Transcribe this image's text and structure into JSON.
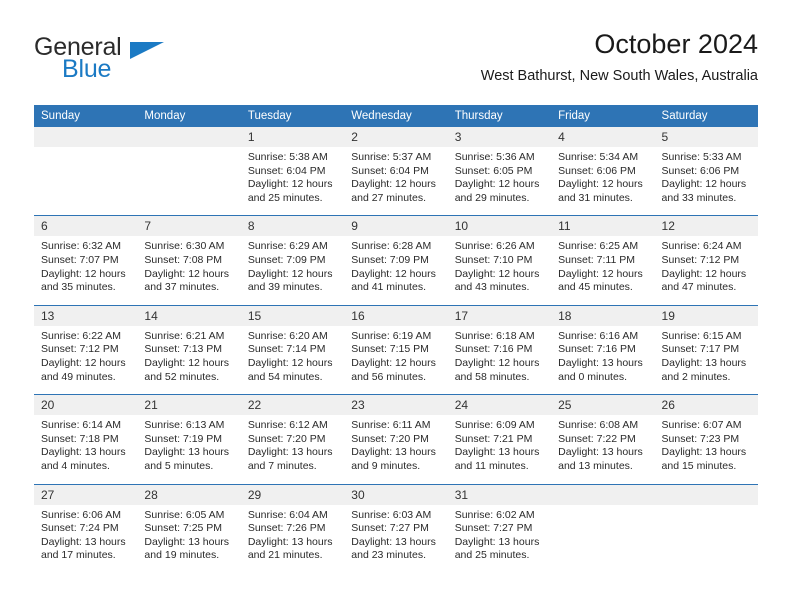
{
  "brand": {
    "name_part1": "General",
    "name_part2": "Blue",
    "accent_color": "#1b7ac4",
    "logo_icon": "triangle-icon"
  },
  "header": {
    "title": "October 2024",
    "subtitle": "West Bathurst, New South Wales, Australia"
  },
  "theme": {
    "header_blue": "#2e74b5",
    "daynum_band": "#f0f0f0",
    "cell_background": "#ffffff",
    "text": "#1a1a1a"
  },
  "calendar": {
    "day_headers": [
      "Sunday",
      "Monday",
      "Tuesday",
      "Wednesday",
      "Thursday",
      "Friday",
      "Saturday"
    ],
    "weeks": [
      {
        "days": [
          {
            "num": "",
            "sunrise": "",
            "sunset": "",
            "daylight1": "",
            "daylight2": ""
          },
          {
            "num": "",
            "sunrise": "",
            "sunset": "",
            "daylight1": "",
            "daylight2": ""
          },
          {
            "num": "1",
            "sunrise": "Sunrise: 5:38 AM",
            "sunset": "Sunset: 6:04 PM",
            "daylight1": "Daylight: 12 hours",
            "daylight2": "and 25 minutes."
          },
          {
            "num": "2",
            "sunrise": "Sunrise: 5:37 AM",
            "sunset": "Sunset: 6:04 PM",
            "daylight1": "Daylight: 12 hours",
            "daylight2": "and 27 minutes."
          },
          {
            "num": "3",
            "sunrise": "Sunrise: 5:36 AM",
            "sunset": "Sunset: 6:05 PM",
            "daylight1": "Daylight: 12 hours",
            "daylight2": "and 29 minutes."
          },
          {
            "num": "4",
            "sunrise": "Sunrise: 5:34 AM",
            "sunset": "Sunset: 6:06 PM",
            "daylight1": "Daylight: 12 hours",
            "daylight2": "and 31 minutes."
          },
          {
            "num": "5",
            "sunrise": "Sunrise: 5:33 AM",
            "sunset": "Sunset: 6:06 PM",
            "daylight1": "Daylight: 12 hours",
            "daylight2": "and 33 minutes."
          }
        ]
      },
      {
        "days": [
          {
            "num": "6",
            "sunrise": "Sunrise: 6:32 AM",
            "sunset": "Sunset: 7:07 PM",
            "daylight1": "Daylight: 12 hours",
            "daylight2": "and 35 minutes."
          },
          {
            "num": "7",
            "sunrise": "Sunrise: 6:30 AM",
            "sunset": "Sunset: 7:08 PM",
            "daylight1": "Daylight: 12 hours",
            "daylight2": "and 37 minutes."
          },
          {
            "num": "8",
            "sunrise": "Sunrise: 6:29 AM",
            "sunset": "Sunset: 7:09 PM",
            "daylight1": "Daylight: 12 hours",
            "daylight2": "and 39 minutes."
          },
          {
            "num": "9",
            "sunrise": "Sunrise: 6:28 AM",
            "sunset": "Sunset: 7:09 PM",
            "daylight1": "Daylight: 12 hours",
            "daylight2": "and 41 minutes."
          },
          {
            "num": "10",
            "sunrise": "Sunrise: 6:26 AM",
            "sunset": "Sunset: 7:10 PM",
            "daylight1": "Daylight: 12 hours",
            "daylight2": "and 43 minutes."
          },
          {
            "num": "11",
            "sunrise": "Sunrise: 6:25 AM",
            "sunset": "Sunset: 7:11 PM",
            "daylight1": "Daylight: 12 hours",
            "daylight2": "and 45 minutes."
          },
          {
            "num": "12",
            "sunrise": "Sunrise: 6:24 AM",
            "sunset": "Sunset: 7:12 PM",
            "daylight1": "Daylight: 12 hours",
            "daylight2": "and 47 minutes."
          }
        ]
      },
      {
        "days": [
          {
            "num": "13",
            "sunrise": "Sunrise: 6:22 AM",
            "sunset": "Sunset: 7:12 PM",
            "daylight1": "Daylight: 12 hours",
            "daylight2": "and 49 minutes."
          },
          {
            "num": "14",
            "sunrise": "Sunrise: 6:21 AM",
            "sunset": "Sunset: 7:13 PM",
            "daylight1": "Daylight: 12 hours",
            "daylight2": "and 52 minutes."
          },
          {
            "num": "15",
            "sunrise": "Sunrise: 6:20 AM",
            "sunset": "Sunset: 7:14 PM",
            "daylight1": "Daylight: 12 hours",
            "daylight2": "and 54 minutes."
          },
          {
            "num": "16",
            "sunrise": "Sunrise: 6:19 AM",
            "sunset": "Sunset: 7:15 PM",
            "daylight1": "Daylight: 12 hours",
            "daylight2": "and 56 minutes."
          },
          {
            "num": "17",
            "sunrise": "Sunrise: 6:18 AM",
            "sunset": "Sunset: 7:16 PM",
            "daylight1": "Daylight: 12 hours",
            "daylight2": "and 58 minutes."
          },
          {
            "num": "18",
            "sunrise": "Sunrise: 6:16 AM",
            "sunset": "Sunset: 7:16 PM",
            "daylight1": "Daylight: 13 hours",
            "daylight2": "and 0 minutes."
          },
          {
            "num": "19",
            "sunrise": "Sunrise: 6:15 AM",
            "sunset": "Sunset: 7:17 PM",
            "daylight1": "Daylight: 13 hours",
            "daylight2": "and 2 minutes."
          }
        ]
      },
      {
        "days": [
          {
            "num": "20",
            "sunrise": "Sunrise: 6:14 AM",
            "sunset": "Sunset: 7:18 PM",
            "daylight1": "Daylight: 13 hours",
            "daylight2": "and 4 minutes."
          },
          {
            "num": "21",
            "sunrise": "Sunrise: 6:13 AM",
            "sunset": "Sunset: 7:19 PM",
            "daylight1": "Daylight: 13 hours",
            "daylight2": "and 5 minutes."
          },
          {
            "num": "22",
            "sunrise": "Sunrise: 6:12 AM",
            "sunset": "Sunset: 7:20 PM",
            "daylight1": "Daylight: 13 hours",
            "daylight2": "and 7 minutes."
          },
          {
            "num": "23",
            "sunrise": "Sunrise: 6:11 AM",
            "sunset": "Sunset: 7:20 PM",
            "daylight1": "Daylight: 13 hours",
            "daylight2": "and 9 minutes."
          },
          {
            "num": "24",
            "sunrise": "Sunrise: 6:09 AM",
            "sunset": "Sunset: 7:21 PM",
            "daylight1": "Daylight: 13 hours",
            "daylight2": "and 11 minutes."
          },
          {
            "num": "25",
            "sunrise": "Sunrise: 6:08 AM",
            "sunset": "Sunset: 7:22 PM",
            "daylight1": "Daylight: 13 hours",
            "daylight2": "and 13 minutes."
          },
          {
            "num": "26",
            "sunrise": "Sunrise: 6:07 AM",
            "sunset": "Sunset: 7:23 PM",
            "daylight1": "Daylight: 13 hours",
            "daylight2": "and 15 minutes."
          }
        ]
      },
      {
        "days": [
          {
            "num": "27",
            "sunrise": "Sunrise: 6:06 AM",
            "sunset": "Sunset: 7:24 PM",
            "daylight1": "Daylight: 13 hours",
            "daylight2": "and 17 minutes."
          },
          {
            "num": "28",
            "sunrise": "Sunrise: 6:05 AM",
            "sunset": "Sunset: 7:25 PM",
            "daylight1": "Daylight: 13 hours",
            "daylight2": "and 19 minutes."
          },
          {
            "num": "29",
            "sunrise": "Sunrise: 6:04 AM",
            "sunset": "Sunset: 7:26 PM",
            "daylight1": "Daylight: 13 hours",
            "daylight2": "and 21 minutes."
          },
          {
            "num": "30",
            "sunrise": "Sunrise: 6:03 AM",
            "sunset": "Sunset: 7:27 PM",
            "daylight1": "Daylight: 13 hours",
            "daylight2": "and 23 minutes."
          },
          {
            "num": "31",
            "sunrise": "Sunrise: 6:02 AM",
            "sunset": "Sunset: 7:27 PM",
            "daylight1": "Daylight: 13 hours",
            "daylight2": "and 25 minutes."
          },
          {
            "num": "",
            "sunrise": "",
            "sunset": "",
            "daylight1": "",
            "daylight2": ""
          },
          {
            "num": "",
            "sunrise": "",
            "sunset": "",
            "daylight1": "",
            "daylight2": ""
          }
        ]
      }
    ]
  }
}
